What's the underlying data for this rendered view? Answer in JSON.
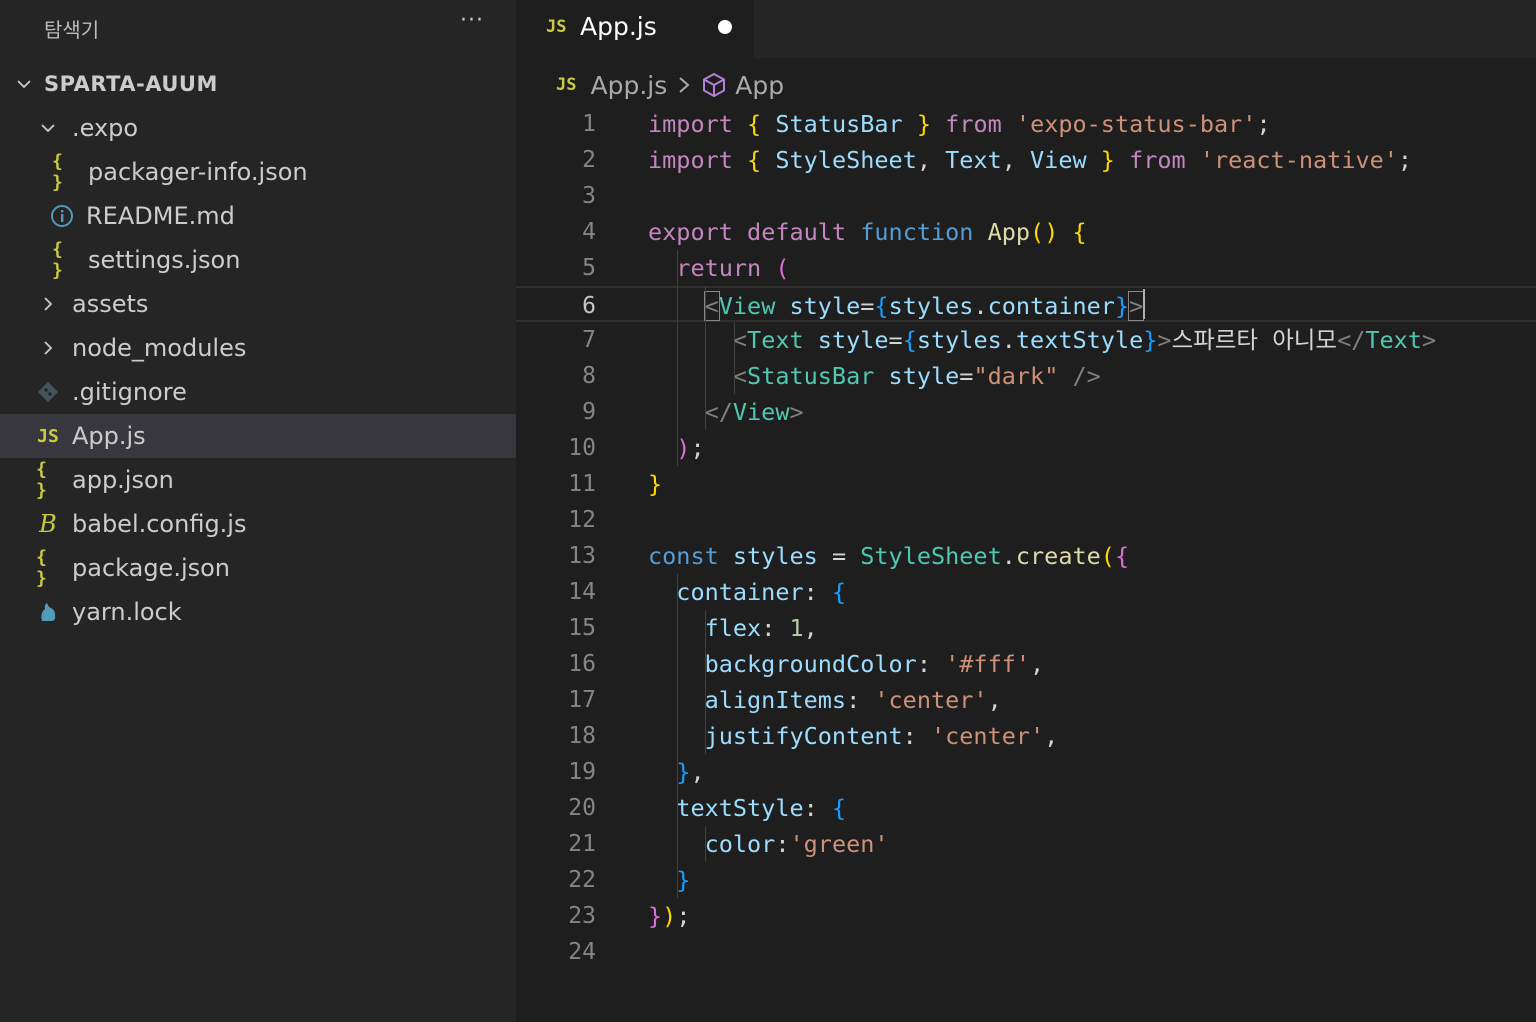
{
  "sidebar": {
    "title": "탐색기",
    "more": "···",
    "root": "SPARTA-AUUM",
    "items": [
      {
        "label": ".expo",
        "kind": "folder-open",
        "icon": "chevron-down-icon"
      },
      {
        "label": "packager-info.json",
        "kind": "json",
        "glyph": "{}"
      },
      {
        "label": "README.md",
        "kind": "info"
      },
      {
        "label": "settings.json",
        "kind": "json",
        "glyph": "{}"
      },
      {
        "label": "assets",
        "kind": "folder"
      },
      {
        "label": "node_modules",
        "kind": "folder"
      },
      {
        "label": ".gitignore",
        "kind": "git"
      },
      {
        "label": "App.js",
        "kind": "js",
        "glyph": "JS",
        "selected": true
      },
      {
        "label": "app.json",
        "kind": "json",
        "glyph": "{}"
      },
      {
        "label": "babel.config.js",
        "kind": "babel",
        "glyph": "B"
      },
      {
        "label": "package.json",
        "kind": "json",
        "glyph": "{}"
      },
      {
        "label": "yarn.lock",
        "kind": "yarn"
      }
    ]
  },
  "tab": {
    "icon": "JS",
    "label": "App.js"
  },
  "breadcrumb": {
    "file_icon": "JS",
    "file": "App.js",
    "symbol": "App"
  },
  "colors": {
    "keyword": "#c586c0",
    "storage": "#569cd6",
    "identifier": "#9cdcfe",
    "type": "#4ec9b0",
    "function": "#dcdcaa",
    "string": "#ce9178",
    "number": "#b5cea8",
    "bracket1": "#ffd700",
    "bracket2": "#da70d6",
    "bracket3": "#179fff"
  },
  "code": [
    [
      [
        "import",
        "kw"
      ],
      [
        " ",
        "p"
      ],
      [
        "{",
        "b1"
      ],
      [
        " ",
        "p"
      ],
      [
        "StatusBar",
        "id"
      ],
      [
        " ",
        "p"
      ],
      [
        "}",
        "b1"
      ],
      [
        " ",
        "p"
      ],
      [
        "from",
        "kw"
      ],
      [
        " ",
        "p"
      ],
      [
        "'expo-status-bar'",
        "str"
      ],
      [
        ";",
        "p"
      ]
    ],
    [
      [
        "import",
        "kw"
      ],
      [
        " ",
        "p"
      ],
      [
        "{",
        "b1"
      ],
      [
        " ",
        "p"
      ],
      [
        "StyleSheet",
        "id"
      ],
      [
        ", ",
        "p"
      ],
      [
        "Text",
        "id"
      ],
      [
        ", ",
        "p"
      ],
      [
        "View",
        "id"
      ],
      [
        " ",
        "p"
      ],
      [
        "}",
        "b1"
      ],
      [
        " ",
        "p"
      ],
      [
        "from",
        "kw"
      ],
      [
        " ",
        "p"
      ],
      [
        "'react-native'",
        "str"
      ],
      [
        ";",
        "p"
      ]
    ],
    [],
    [
      [
        "export",
        "kw"
      ],
      [
        " ",
        "p"
      ],
      [
        "default",
        "kw"
      ],
      [
        " ",
        "p"
      ],
      [
        "function",
        "st"
      ],
      [
        " ",
        "p"
      ],
      [
        "App",
        "fn"
      ],
      [
        "()",
        "b1"
      ],
      [
        " ",
        "p"
      ],
      [
        "{",
        "b1"
      ]
    ],
    [
      [
        "  ",
        "p"
      ],
      [
        "return",
        "kw"
      ],
      [
        " ",
        "p"
      ],
      [
        "(",
        "b2"
      ]
    ],
    [
      [
        "    ",
        "p"
      ],
      [
        "<",
        "tagp"
      ],
      [
        "View",
        "tag"
      ],
      [
        " ",
        "p"
      ],
      [
        "style",
        "id"
      ],
      [
        "=",
        "p"
      ],
      [
        "{",
        "b3"
      ],
      [
        "styles",
        "id"
      ],
      [
        ".",
        "p"
      ],
      [
        "container",
        "id"
      ],
      [
        "}",
        "b3"
      ],
      [
        ">",
        "tagp"
      ]
    ],
    [
      [
        "      ",
        "p"
      ],
      [
        "<",
        "tagp"
      ],
      [
        "Text",
        "tag"
      ],
      [
        " ",
        "p"
      ],
      [
        "style",
        "id"
      ],
      [
        "=",
        "p"
      ],
      [
        "{",
        "b3"
      ],
      [
        "styles",
        "id"
      ],
      [
        ".",
        "p"
      ],
      [
        "textStyle",
        "id"
      ],
      [
        "}",
        "b3"
      ],
      [
        ">",
        "tagp"
      ],
      [
        "스파르타 아니모",
        "p"
      ],
      [
        "</",
        "tagp"
      ],
      [
        "Text",
        "tag"
      ],
      [
        ">",
        "tagp"
      ]
    ],
    [
      [
        "      ",
        "p"
      ],
      [
        "<",
        "tagp"
      ],
      [
        "StatusBar",
        "tag"
      ],
      [
        " ",
        "p"
      ],
      [
        "style",
        "id"
      ],
      [
        "=",
        "p"
      ],
      [
        "\"dark\"",
        "str"
      ],
      [
        " ",
        "p"
      ],
      [
        "/>",
        "tagp"
      ]
    ],
    [
      [
        "    ",
        "p"
      ],
      [
        "</",
        "tagp"
      ],
      [
        "View",
        "tag"
      ],
      [
        ">",
        "tagp"
      ]
    ],
    [
      [
        "  ",
        "p"
      ],
      [
        ")",
        "b2"
      ],
      [
        ";",
        "p"
      ]
    ],
    [
      [
        "}",
        "b1"
      ]
    ],
    [],
    [
      [
        "const",
        "st"
      ],
      [
        " ",
        "p"
      ],
      [
        "styles",
        "id"
      ],
      [
        " = ",
        "p"
      ],
      [
        "StyleSheet",
        "type"
      ],
      [
        ".",
        "p"
      ],
      [
        "create",
        "fn"
      ],
      [
        "(",
        "b1"
      ],
      [
        "{",
        "b2"
      ]
    ],
    [
      [
        "  ",
        "p"
      ],
      [
        "container",
        "id"
      ],
      [
        ": ",
        "p"
      ],
      [
        "{",
        "b3"
      ]
    ],
    [
      [
        "    ",
        "p"
      ],
      [
        "flex",
        "id"
      ],
      [
        ": ",
        "p"
      ],
      [
        "1",
        "num"
      ],
      [
        ",",
        "p"
      ]
    ],
    [
      [
        "    ",
        "p"
      ],
      [
        "backgroundColor",
        "id"
      ],
      [
        ": ",
        "p"
      ],
      [
        "'#fff'",
        "str"
      ],
      [
        ",",
        "p"
      ]
    ],
    [
      [
        "    ",
        "p"
      ],
      [
        "alignItems",
        "id"
      ],
      [
        ": ",
        "p"
      ],
      [
        "'center'",
        "str"
      ],
      [
        ",",
        "p"
      ]
    ],
    [
      [
        "    ",
        "p"
      ],
      [
        "justifyContent",
        "id"
      ],
      [
        ": ",
        "p"
      ],
      [
        "'center'",
        "str"
      ],
      [
        ",",
        "p"
      ]
    ],
    [
      [
        "  ",
        "p"
      ],
      [
        "}",
        "b3"
      ],
      [
        ",",
        "p"
      ]
    ],
    [
      [
        "  ",
        "p"
      ],
      [
        "textStyle",
        "id"
      ],
      [
        ": ",
        "p"
      ],
      [
        "{",
        "b3"
      ]
    ],
    [
      [
        "    ",
        "p"
      ],
      [
        "color",
        "id"
      ],
      [
        ":",
        "p"
      ],
      [
        "'green'",
        "str"
      ]
    ],
    [
      [
        "  ",
        "p"
      ],
      [
        "}",
        "b3"
      ]
    ],
    [
      [
        "}",
        "b2"
      ],
      [
        ")",
        "b1"
      ],
      [
        ";",
        "p"
      ]
    ],
    []
  ],
  "active_line": 6
}
